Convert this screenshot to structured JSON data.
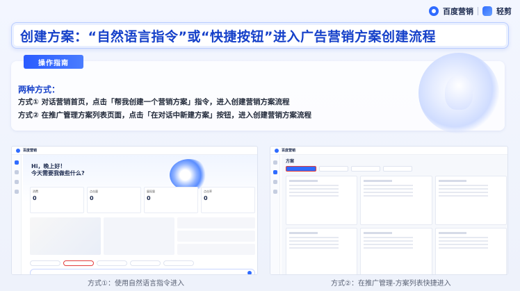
{
  "brand": {
    "baidu": "百度营销",
    "qingjian": "轻剪"
  },
  "banner": {
    "title": "创建方案：“自然语言指令”或“快捷按钮”进入广告营销方案创建流程"
  },
  "guide": {
    "tag": "操作指南",
    "heading": "两种方式：",
    "line1": "方式① 对话营销首页，点击「帮我创建一个营销方案」指令，进入创建营销方案流程",
    "line2": "方式② 在推广管理方案列表页面，点击「在对话中新建方案」按钮，进入创建营销方案流程"
  },
  "screens": {
    "method1": {
      "greeting_line1": "Hi，晚上好！",
      "greeting_line2": "今天需要我做些什么?",
      "stats": [
        "消费",
        "点击量",
        "展现量",
        "点击率"
      ],
      "stat_values": [
        "0",
        "0",
        "0",
        "0"
      ]
    },
    "method2": {
      "heading": "方案"
    }
  },
  "captions": {
    "method1": "方式①：使用自然语言指令进入",
    "method2": "方式②：在推广管理-方案列表快捷进入"
  },
  "colors": {
    "accent": "#1540c9",
    "highlight": "#e23b3b"
  }
}
